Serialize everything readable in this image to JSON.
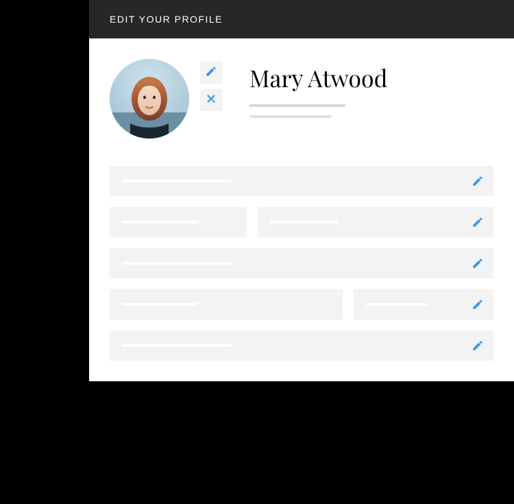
{
  "header": {
    "title": "EDIT YOUR PROFILE"
  },
  "profile": {
    "display_name": "Mary Atwood"
  },
  "icons": {
    "edit": "pencil-icon",
    "remove": "close-icon"
  },
  "colors": {
    "accent": "#3b99ed",
    "header_bg": "#272727",
    "field_bg": "#f3f3f3"
  }
}
